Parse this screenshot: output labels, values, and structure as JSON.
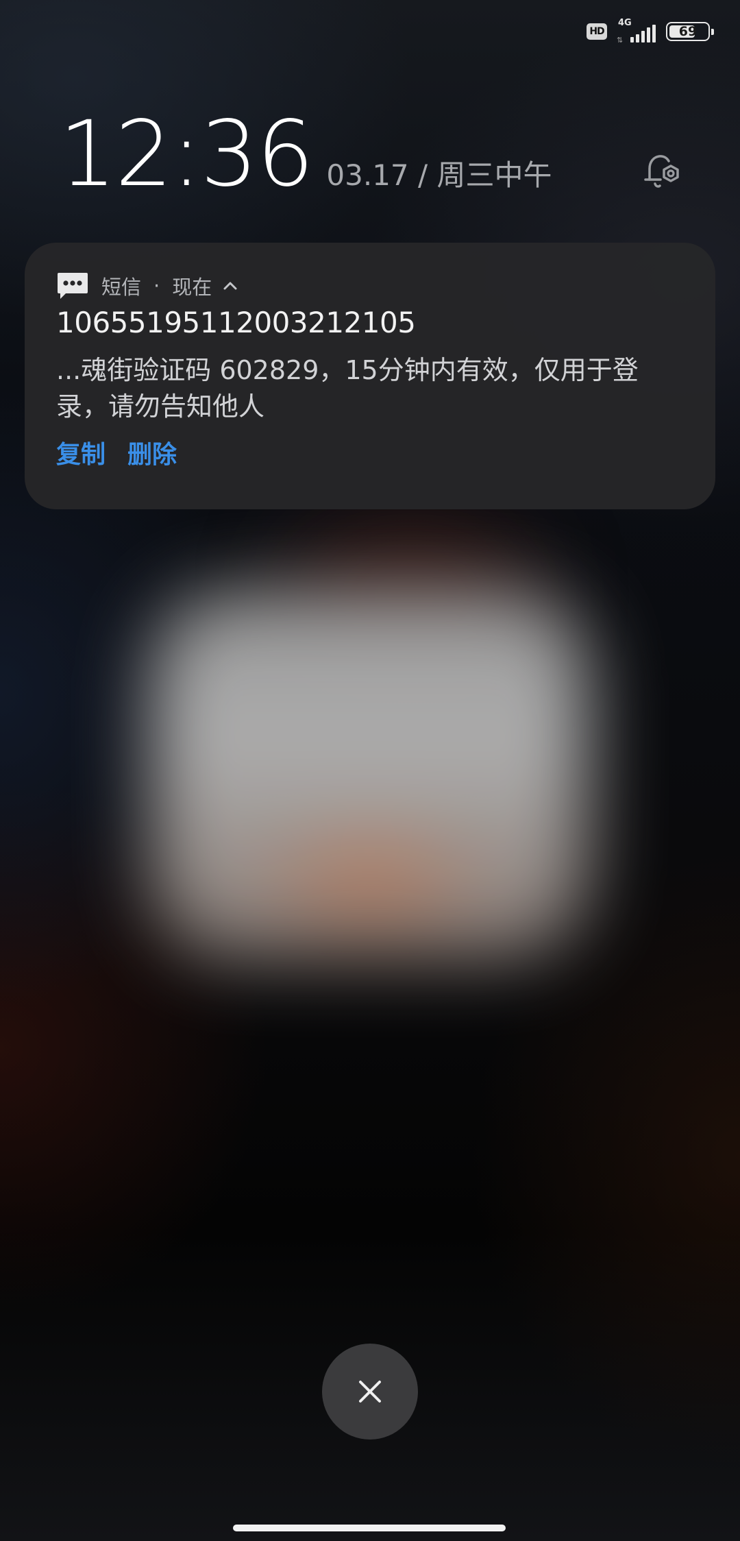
{
  "status_bar": {
    "hd_label": "HD",
    "network_label": "4G",
    "battery_level": "69",
    "battery_percent": 69,
    "icons": [
      "hd-icon",
      "signal-bars-icon",
      "battery-icon"
    ]
  },
  "lockscreen": {
    "time": "12:36",
    "date": "03.17 / 周三中午",
    "notification_settings_icon": "bell-gear-icon"
  },
  "notification": {
    "app_icon": "sms-bubble-icon",
    "app_name": "短信",
    "separator": "·",
    "time": "现在",
    "expand_icon": "chevron-up-icon",
    "title": "10655195112003212105",
    "body": "...魂街验证码 602829，15分钟内有效，仅用于登录，请勿告知他人",
    "actions": [
      {
        "label": "复制"
      },
      {
        "label": "删除"
      }
    ],
    "accent_color": "#3a8fe8"
  },
  "bottom": {
    "close_icon": "close-icon"
  }
}
